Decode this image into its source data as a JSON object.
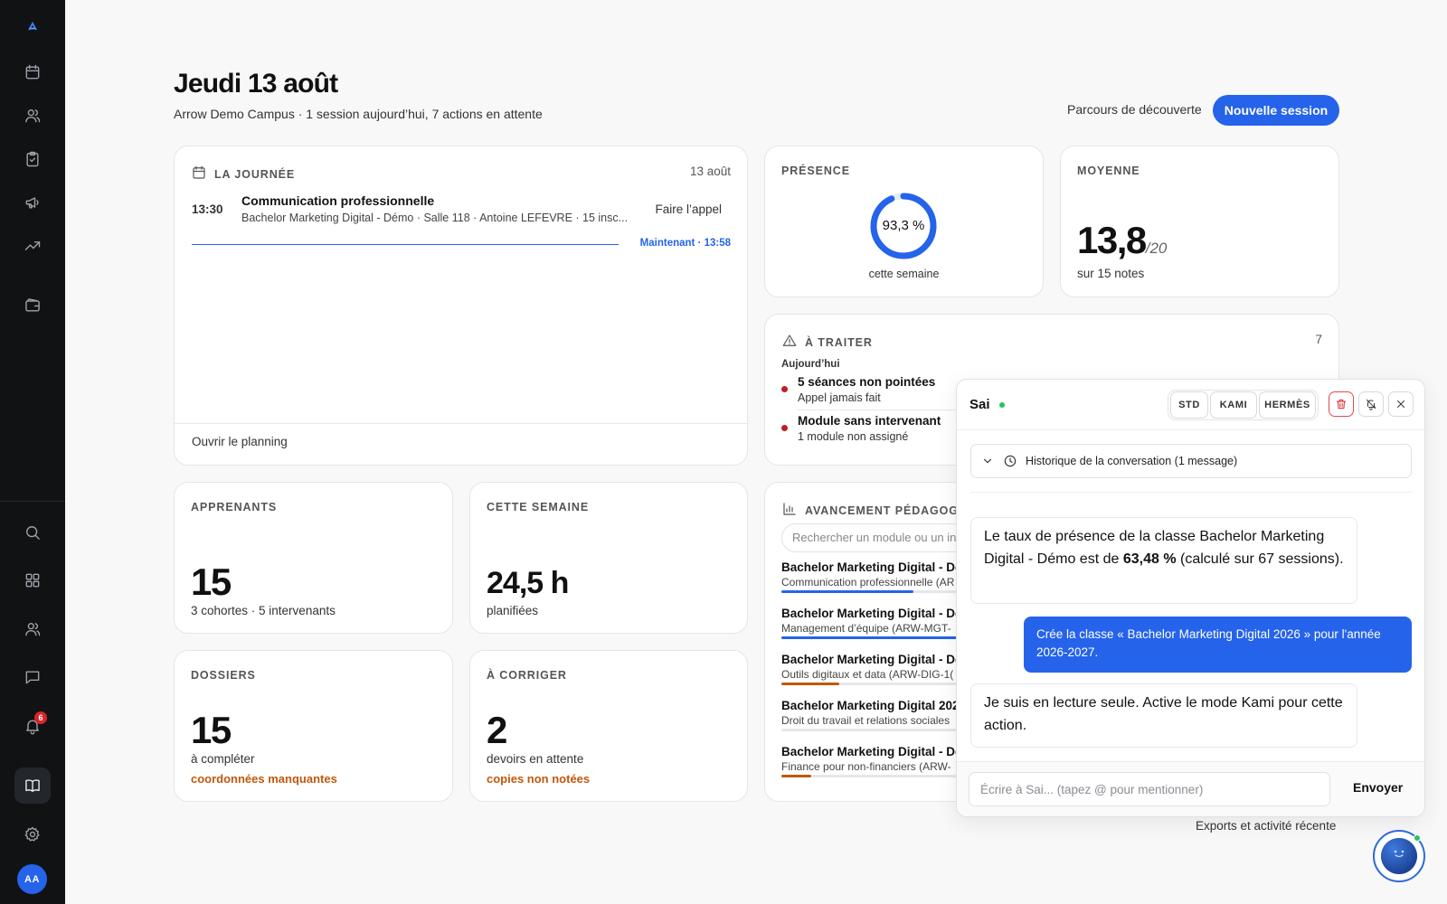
{
  "sidebar": {
    "logo_icon": "arrow-logo-icon",
    "nav_icons": [
      "calendar-icon",
      "users-icon",
      "clipboard-check-icon",
      "megaphone-icon",
      "trending-up-icon",
      "wallet-icon"
    ],
    "tool_icons": [
      "search-icon",
      "grid-icon",
      "users-icon",
      "chat-icon",
      "bell-icon",
      "book-icon",
      "gear-icon"
    ],
    "notification_count": "6",
    "avatar_initials": "AA"
  },
  "header": {
    "title": "Jeudi 13 août",
    "subtitle": "Arrow Demo Campus · 1 session aujourd’hui, 7 actions en attente",
    "discover_link": "Parcours de découverte",
    "new_session_button": "Nouvelle session"
  },
  "day_card": {
    "label": "LA JOURNÉE",
    "date": "13 août",
    "session": {
      "time": "13:30",
      "title": "Communication professionnelle",
      "details": "Bachelor Marketing Digital - Démo · Salle 118 · Antoine LEFEVRE · 15 insc...",
      "action": "Faire l’appel"
    },
    "now_label": "Maintenant · 13:58",
    "footer_link": "Ouvrir le planning"
  },
  "presence_card": {
    "label": "PRÉSENCE",
    "value": "93,3 %",
    "ratio": 0.933,
    "caption": "cette semaine"
  },
  "average_card": {
    "label": "MOYENNE",
    "value": "13,8",
    "scale": "/20",
    "caption": "sur 15 notes"
  },
  "todo_card": {
    "label": "À TRAITER",
    "count": "7",
    "group": "Aujourd’hui",
    "items": [
      {
        "title": "5 séances non pointées",
        "detail": "Appel jamais fait"
      },
      {
        "title": "Module sans intervenant",
        "detail": "1 module non assigné"
      }
    ]
  },
  "learners_card": {
    "label": "APPRENANTS",
    "value": "15",
    "caption": "3 cohortes · 5 intervenants"
  },
  "week_card": {
    "label": "CETTE SEMAINE",
    "value": "24,5 h",
    "caption": "planifiées"
  },
  "files_card": {
    "label": "DOSSIERS",
    "value": "15",
    "caption": "à compléter",
    "warning": "coordonnées manquantes"
  },
  "grading_card": {
    "label": "À CORRIGER",
    "value": "2",
    "caption": "devoirs en attente",
    "warning": "copies non notées"
  },
  "progress_card": {
    "label": "AVANCEMENT PÉDAGOG",
    "search_placeholder": "Rechercher un module ou un in",
    "modules": [
      {
        "class": "Bachelor Marketing Digital - Dé",
        "module": "Communication professionnelle (AR",
        "progress": 0.75,
        "color": "#2563eb"
      },
      {
        "class": "Bachelor Marketing Digital - Dé",
        "module": "Management d’équipe (ARW-MGT-",
        "progress": 1.0,
        "color": "#2563eb"
      },
      {
        "class": "Bachelor Marketing Digital - Dé",
        "module": "Outils digitaux et data (ARW-DIG-1(",
        "progress": 0.33,
        "color": "#c2570c"
      },
      {
        "class": "Bachelor Marketing Digital 202",
        "module": "Droit du travail et relations sociales",
        "progress": 0.0,
        "color": "#2563eb"
      },
      {
        "class": "Bachelor Marketing Digital - Dé",
        "module": "Finance pour non-financiers (ARW-",
        "progress": 0.17,
        "color": "#c2570c"
      }
    ]
  },
  "exports_link": "Exports et activité récente",
  "chat": {
    "name": "Sai",
    "modes": [
      "STD",
      "KAMI",
      "HERMÈS"
    ],
    "history": "Historique de la conversation (1 message)",
    "messages": [
      {
        "role": "assistant",
        "before": "Le taux de présence de la classe Bachelor Marketing Digital - Démo est de ",
        "bold": "63,48 %",
        "after": " (calculé sur 67 sessions)."
      },
      {
        "role": "user",
        "text": "Crée la classe « Bachelor Marketing Digital 2026 » pour l'année 2026-2027."
      },
      {
        "role": "assistant",
        "text": "Je suis en lecture seule. Active le mode Kami pour cette action."
      }
    ],
    "input_placeholder": "Écrire à Sai... (tapez @ pour mentionner)",
    "send_label": "Envoyer"
  },
  "colors": {
    "accent": "#2563eb",
    "warning": "#c2570c",
    "danger": "#d9262b",
    "online": "#22c55e"
  }
}
